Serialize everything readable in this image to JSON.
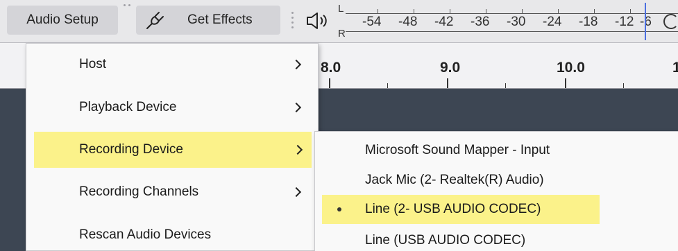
{
  "toolbar": {
    "audio_setup_label": "Audio Setup",
    "get_effects_label": "Get Effects",
    "meter_left": "L",
    "meter_right": "R",
    "meter_ticks": [
      "-54",
      "-48",
      "-42",
      "-36",
      "-30",
      "-24",
      "-18",
      "-12",
      "-6"
    ]
  },
  "ruler": {
    "labels": [
      "8.0",
      "9.0",
      "10.0",
      "1"
    ]
  },
  "audio_setup_menu": {
    "items": [
      {
        "label": "Host",
        "has_submenu": true,
        "highlighted": false
      },
      {
        "label": "Playback Device",
        "has_submenu": true,
        "highlighted": false
      },
      {
        "label": "Recording Device",
        "has_submenu": true,
        "highlighted": true
      },
      {
        "label": "Recording Channels",
        "has_submenu": true,
        "highlighted": false
      },
      {
        "label": "Rescan Audio Devices",
        "has_submenu": false,
        "highlighted": false
      }
    ]
  },
  "recording_device_submenu": {
    "items": [
      {
        "label": "Microsoft Sound Mapper - Input",
        "selected": false,
        "highlighted": false
      },
      {
        "label": "Jack Mic (2- Realtek(R) Audio)",
        "selected": false,
        "highlighted": false
      },
      {
        "label": "Line (2- USB AUDIO  CODEC)",
        "selected": true,
        "highlighted": true
      },
      {
        "label": "Line (USB AUDIO  CODEC)",
        "selected": false,
        "highlighted": false
      }
    ]
  },
  "colors": {
    "highlight": "#fbf28a",
    "meter_cursor": "#4b6fe0",
    "track_bg": "#3d4653"
  }
}
